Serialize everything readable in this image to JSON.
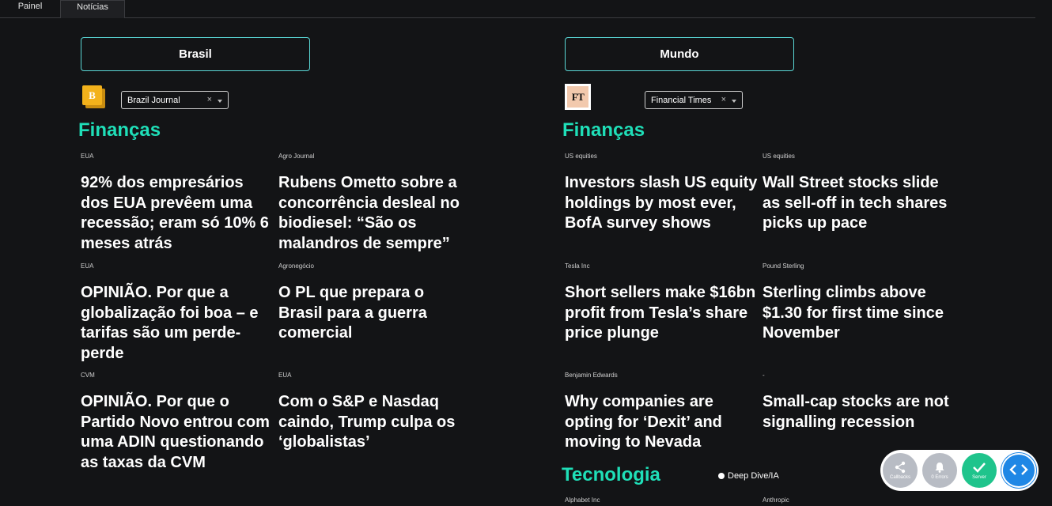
{
  "tabs": [
    {
      "label": "Painel",
      "active": false
    },
    {
      "label": "Notícias",
      "active": true
    }
  ],
  "brasil": {
    "region_label": "Brasil",
    "logo_letter": "B",
    "source_selected": "Brazil Journal",
    "clear_glyph": "×",
    "section_title": "Finanças",
    "articles": [
      {
        "tag": "EUA",
        "headline": "92% dos empresários dos EUA prevêem uma recessão; eram só 10% 6 meses atrás"
      },
      {
        "tag": "Agro Journal",
        "headline": "Rubens Ometto sobre a concorrência desleal no biodiesel: “São os malandros de sempre”"
      },
      {
        "tag": "EUA",
        "headline": "OPINIÃO. Por que a globalização foi boa – e tarifas são um perde-perde"
      },
      {
        "tag": "Agronegócio",
        "headline": "O PL que prepara o Brasil para a guerra comercial"
      },
      {
        "tag": "CVM",
        "headline": "OPINIÃO. Por que o Partido Novo entrou com uma ADIN questionando as taxas da CVM"
      },
      {
        "tag": "EUA",
        "headline": "Com o S&P e Nasdaq caindo, Trump culpa os ‘globalistas’"
      }
    ]
  },
  "mundo": {
    "region_label": "Mundo",
    "logo_text": "FT",
    "source_selected": "Financial Times",
    "clear_glyph": "×",
    "section_title": "Finanças",
    "articles": [
      {
        "tag": "US equities",
        "headline": "Investors slash US equity holdings by most ever, BofA survey shows"
      },
      {
        "tag": "US equities",
        "headline": "Wall Street stocks slide as sell-off in tech shares picks up pace"
      },
      {
        "tag": "Tesla Inc",
        "headline": "Short sellers make $16bn profit from Tesla’s share price plunge"
      },
      {
        "tag": "Pound Sterling",
        "headline": "Sterling climbs above $1.30 for first time since November"
      },
      {
        "tag": "Benjamin Edwards",
        "headline": "Why companies are opting for ‘Dexit’ and moving to Nevada"
      },
      {
        "tag": "-",
        "headline": "Small-cap stocks are not signalling recession"
      }
    ],
    "tech_title": "Tecnologia",
    "tech_option": "Deep Dive/IA",
    "tech_articles": [
      {
        "tag": "Alphabet Inc"
      },
      {
        "tag": "Anthropic"
      }
    ]
  },
  "devtools": {
    "callbacks_label": "Callbacks",
    "errors_label": "0 Errors",
    "server_label": "Server",
    "colors": {
      "gray": "#b8bcc4",
      "green": "#1fc48c",
      "blue": "#1f87e5"
    }
  },
  "colors": {
    "accent": "#1fdfb8",
    "border": "#5ad8d6",
    "background": "#131416"
  }
}
